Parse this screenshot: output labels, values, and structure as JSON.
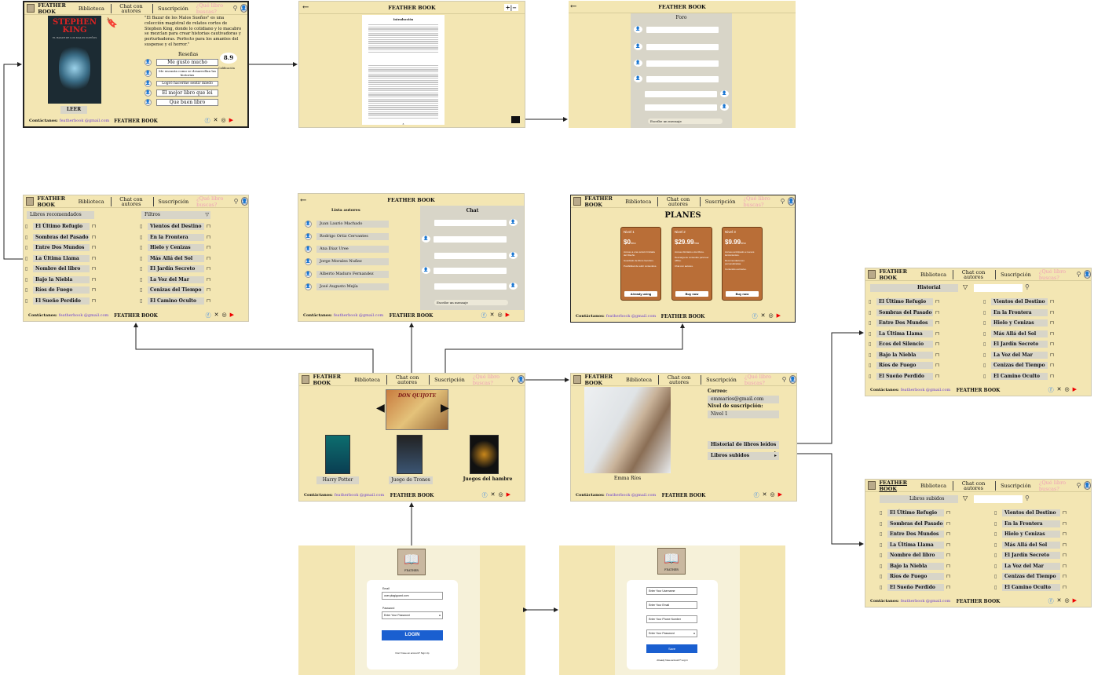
{
  "nav": {
    "brand": "FEATHER BOOK",
    "biblioteca": "Biblioteca",
    "chat": "Chat con autores",
    "suscripcion": "Suscripción",
    "search_placeholder": "¿Qué libro buscas?"
  },
  "footer": {
    "contact_label": "Contáctanos:",
    "email": "featherbook @gmail.com",
    "brand": "FEATHER BOOK"
  },
  "book_detail": {
    "cover_author": "STEPHEN KING",
    "cover_title": "EL BAZAR DE LOS MALOS SUEÑOS",
    "description": "\"El Bazar de los Malos Sueños\" es una colección magistral de relatos cortos de Stephen King, donde lo cotidiano y lo macabro se mezclan para crear historias cautivadoras y perturbadoras. Perfecto para los amantes del suspense y el horror.\"",
    "reviews_title": "Reseñas",
    "reviews": [
      "Me gusto mucho",
      "Me encanta como se desarrollan las historias",
      "Logró hacerme sentir miedo",
      "El mejor libro que lei",
      "Que buen libro"
    ],
    "rating": "8.9",
    "rating_label": "Calificación",
    "read_button": "LEER"
  },
  "reader": {
    "title": "FEATHER BOOK",
    "page_heading": "Introducción",
    "page_number": "3",
    "zoom_label": "+|−"
  },
  "forum": {
    "title": "FEATHER BOOK",
    "heading": "Foro",
    "input_placeholder": "Escribe un mensaje"
  },
  "library": {
    "recommended_label": "Libros recomendados",
    "filters_label": "Filtros",
    "left_books": [
      "El Último Refugio",
      "Sombras del Pasado",
      "Entre Dos Mundos",
      "La Última Llama",
      "Nombre del libro",
      "Bajo la Niebla",
      "Ríos de Fuego",
      "El Sueño Perdido"
    ],
    "right_books": [
      "Vientos del Destino",
      "En la Frontera",
      "Hielo y Cenizas",
      "Más Allá del Sol",
      "El Jardín Secreto",
      "La Voz del Mar",
      "Cenizas del Tiempo",
      "El Camino Oculto"
    ]
  },
  "chat_authors": {
    "title": "FEATHER BOOK",
    "list_label": "Lista autores",
    "chat_label": "Chat",
    "authors": [
      "Juan Laurio Machado",
      "Rodrigo Ortiz Cervantes",
      "Ana Diaz Uree",
      "Jorge Morales Nuñez",
      "Alberto Maduro Fernandez",
      "José Augusto Mejía"
    ],
    "input_placeholder": "Escribe un mensaje"
  },
  "plans": {
    "title": "PLANES",
    "items": [
      {
        "name": "Nivel 1",
        "price": "$0",
        "period": "/mo",
        "features": [
          "Acceso a una versión limitada del Diseño.",
          "Guardado de libros favoritos.",
          "Posibilidad de subir contenidos."
        ],
        "button": "Already using"
      },
      {
        "name": "Nivel 2",
        "price": "$29.99",
        "period": "/mo",
        "features": [
          "Acceso ilimitado a los libros.",
          "Descarga de contenido para leer offline.",
          "Chat con autores."
        ],
        "button": "Buy now"
      },
      {
        "name": "Nivel 3",
        "price": "$9.99",
        "period": "/mo",
        "features": [
          "Acceso anticipado a nuevos lanzamientos.",
          "Recomendaciones personalizadas.",
          "Contenido exclusivo."
        ],
        "button": "Buy now"
      }
    ]
  },
  "home": {
    "featured": [
      {
        "title": "Harry Potter"
      },
      {
        "title": "Juego de Tronos"
      },
      {
        "title": "Juegos del hambre"
      }
    ],
    "carousel_title": "DON QUIJOTE"
  },
  "profile": {
    "email_label": "Correo:",
    "email": "emmarios@gmail.com",
    "level_label": "Nivel de suscripción:",
    "level": "Nivel 1",
    "name": "Emma Ríos",
    "history_button": "Historial de libros leídos",
    "uploaded_button": "Libros subidos"
  },
  "history": {
    "label": "Historial",
    "left_books": [
      "El Último Refugio",
      "Sombras del Pasado",
      "Entre Dos Mundos",
      "La Última Llama",
      "Ecos del Silencio",
      "Bajo la Niebla",
      "Ríos de Fuego",
      "El Sueño Perdido"
    ],
    "right_books": [
      "Vientos del Destino",
      "En la Frontera",
      "Hielo y Cenizas",
      "Más Allá del Sol",
      "El Jardín Secreto",
      "La Voz del Mar",
      "Cenizas del Tiempo",
      "El Camino Oculto"
    ]
  },
  "uploaded": {
    "label": "Libros subidos",
    "left_books": [
      "El Último Refugio",
      "Sombras del Pasado",
      "Entre Dos Mundos",
      "La Última Llama",
      "Nombre del libro",
      "Bajo la Niebla",
      "Ríos de Fuego",
      "El Sueño Perdido"
    ],
    "right_books": [
      "Vientos del Destino",
      "En la Frontera",
      "Hielo y Cenizas",
      "Más Allá del Sol",
      "El Jardín Secreto",
      "La Voz del Mar",
      "Cenizas del Tiempo",
      "El Camino Oculto"
    ]
  },
  "login": {
    "logo_text": "FEATHER",
    "email_label": "Email",
    "email_value": "user.plagiguard.com",
    "password_label": "Password",
    "password_placeholder": "Enter Your Password",
    "button": "LOGIN",
    "signup_prompt": "Don't have an account? Sign Up"
  },
  "register": {
    "logo_text": "FEATHER",
    "username_placeholder": "Enter Your Username",
    "email_placeholder": "Enter Your Email",
    "phone_placeholder": "Enter Your Phone Number",
    "password_placeholder": "Enter Your Password",
    "button": "Save",
    "login_prompt": "Already have account? Log in"
  }
}
